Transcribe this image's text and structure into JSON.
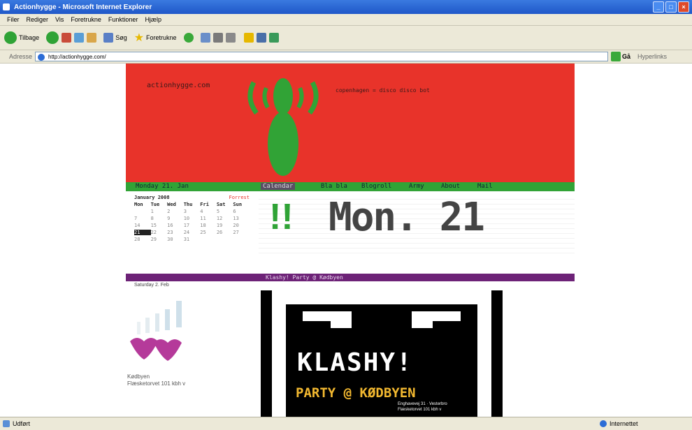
{
  "window": {
    "title": "Actionhygge - Microsoft Internet Explorer",
    "controls": [
      "_",
      "□",
      "×"
    ]
  },
  "menu": [
    "Filer",
    "Rediger",
    "Vis",
    "Foretrukne",
    "Funktioner",
    "Hjælp"
  ],
  "toolbar": {
    "back_label": "Tilbage",
    "search_label": "Søg",
    "favorites_label": "Foretrukne"
  },
  "address": {
    "label": "Adresse",
    "url": "http://actionhygge.com/",
    "go_label": "Gå",
    "links_label": "Hyperlinks"
  },
  "status": {
    "left": "Udført",
    "zone": "Internettet"
  },
  "site": {
    "logo_text": "actionhygge.com",
    "tagline": "copenhagen = disco disco bot",
    "nav_date": "Monday 21. Jan",
    "nav": [
      "Calendar",
      "Bla bla",
      "Blogroll",
      "Army",
      "About",
      "Mail"
    ],
    "calendar": {
      "month": "January 2008",
      "next_label": "Forrest",
      "day_names": [
        "Mon",
        "Tue",
        "Wed",
        "Thu",
        "Fri",
        "Sat",
        "Sun"
      ],
      "weeks": [
        [
          "",
          "1",
          "2",
          "3",
          "4",
          "5",
          "6"
        ],
        [
          "7",
          "8",
          "9",
          "10",
          "11",
          "12",
          "13"
        ],
        [
          "14",
          "15",
          "16",
          "17",
          "18",
          "19",
          "20"
        ],
        [
          "21",
          "22",
          "23",
          "24",
          "25",
          "26",
          "27"
        ],
        [
          "28",
          "29",
          "30",
          "31",
          "",
          "",
          ""
        ]
      ],
      "today": "21"
    },
    "exclaim": "!!",
    "big_date": "Mon. 21",
    "post_title": "Klashy! Party @ Kødbyen",
    "post_date": "Saturday 2. Feb",
    "side_credit": [
      "Kødbyen",
      "Flæsketorvet 101 kbh v"
    ],
    "poster": {
      "title": "KLASHY!",
      "subtitle": "PARTY @ KØDBYEN",
      "address": "Enghavevej 31 · Vesterbro",
      "address2": "Flæsketorvet 101 kbh v"
    }
  },
  "colors": {
    "header_red": "#e8332a",
    "nav_green": "#31a336",
    "post_purple": "#6d2277",
    "xp_blue": "#1f57c8"
  }
}
